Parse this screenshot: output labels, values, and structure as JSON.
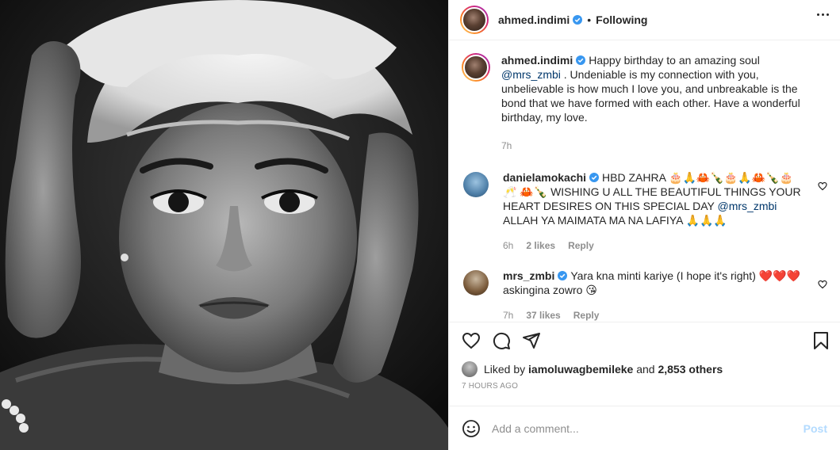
{
  "header": {
    "username": "ahmed.indimi",
    "separator": "•",
    "follow_status": "Following"
  },
  "caption": {
    "username": "ahmed.indimi",
    "text_before": "Happy birthday to an amazing soul",
    "mention": "@mrs_zmbi",
    "text_after": ". Undeniable is my connection with you, unbelievable is how much I love you, and unbreakable is the bond that we have formed with each other. Have a wonderful birthday, my love.",
    "time": "7h"
  },
  "comments": [
    {
      "username": "danielamokachi",
      "text_before": "HBD ZAHRA 🎂🙏🦀🍾🎂🙏🦀🍾🎂🥂 🦀🍾 WISHING U ALL THE BEAUTIFUL THINGS YOUR HEART DESIRES ON THIS SPECIAL DAY",
      "mention": "@mrs_zmbi",
      "text_after": "ALLAH YA MAIMATA MA NA LAFIYA 🙏🙏🙏",
      "time": "6h",
      "likes": "2 likes",
      "reply": "Reply"
    },
    {
      "username": "mrs_zmbi",
      "text_before": "Yara kna minti kariye (I hope it's right) ❤️❤️❤️ askingina zowro 😘",
      "mention": "",
      "text_after": "",
      "time": "7h",
      "likes": "37 likes",
      "reply": "Reply"
    }
  ],
  "likes": {
    "prefix": "Liked by",
    "user": "iamoluwagbemileke",
    "middle": "and",
    "others": "2,853 others"
  },
  "post_time": "7 HOURS AGO",
  "add_comment": {
    "placeholder": "Add a comment...",
    "post_label": "Post"
  },
  "colors": {
    "verified": "#3897f0",
    "mention": "#00376b",
    "post_disabled": "#b3dbff",
    "muted": "#8e8e8e"
  },
  "icons": [
    "more-options-icon",
    "verified-badge-icon",
    "heart-icon",
    "comment-icon",
    "share-icon",
    "bookmark-icon",
    "emoji-icon"
  ]
}
